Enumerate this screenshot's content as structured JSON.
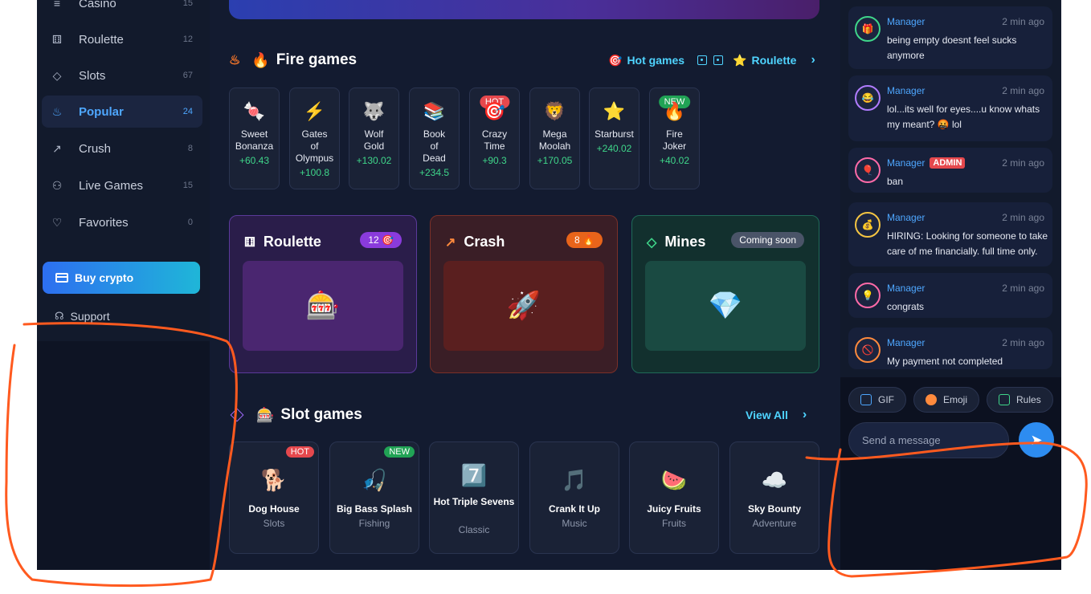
{
  "sidebar": {
    "items": [
      {
        "label": "Casino",
        "count": "15",
        "icon": "casino-icon"
      },
      {
        "label": "Roulette",
        "count": "12",
        "icon": "roulette-icon"
      },
      {
        "label": "Slots",
        "count": "67",
        "icon": "diamond-icon"
      },
      {
        "label": "Popular",
        "count": "24",
        "icon": "flame-icon"
      },
      {
        "label": "Crush",
        "count": "8",
        "icon": "trend-icon"
      },
      {
        "label": "Live Games",
        "count": "15",
        "icon": "users-icon"
      },
      {
        "label": "Favorites",
        "count": "0",
        "icon": "heart-icon"
      }
    ],
    "buy_label": "Buy crypto",
    "support_label": "Support"
  },
  "fire": {
    "title": "Fire games",
    "tabs": {
      "hot": "Hot games",
      "roulette": "Roulette"
    },
    "games": [
      {
        "name": "Sweet Bonanza",
        "value": "+60.43",
        "emoji": "🍬"
      },
      {
        "name": "Gates of Olympus",
        "value": "+100.8",
        "emoji": "⚡"
      },
      {
        "name": "Wolf Gold",
        "value": "+130.02",
        "emoji": "🐺"
      },
      {
        "name": "Book of Dead",
        "value": "+234.5",
        "emoji": "📚"
      },
      {
        "name": "Crazy Time",
        "value": "+90.3",
        "emoji": "🎯",
        "tag": "HOT"
      },
      {
        "name": "Mega Moolah",
        "value": "+170.05",
        "emoji": "🦁"
      },
      {
        "name": "Starburst",
        "value": "+240.02",
        "emoji": "⭐"
      },
      {
        "name": "Fire Joker",
        "value": "+40.02",
        "emoji": "🔥",
        "tag": "NEW"
      }
    ]
  },
  "modes": {
    "roulette": {
      "title": "Roulette",
      "badge": "12 🎯",
      "pic": "🎰"
    },
    "crash": {
      "title": "Crash",
      "badge": "8 🔥",
      "pic": "🚀"
    },
    "mines": {
      "title": "Mines",
      "badge": "Coming soon",
      "pic": "💎"
    }
  },
  "slots": {
    "title": "Slot games",
    "view_all": "View All",
    "games": [
      {
        "name": "Dog House",
        "category": "Slots",
        "emoji": "🐕",
        "tag": "HOT"
      },
      {
        "name": "Big Bass Splash",
        "category": "Fishing",
        "emoji": "🎣",
        "tag": "NEW"
      },
      {
        "name": "Hot Triple Sevens",
        "category": "Classic",
        "emoji": "7️⃣"
      },
      {
        "name": "Crank It Up",
        "category": "Music",
        "emoji": "🎵"
      },
      {
        "name": "Juicy Fruits",
        "category": "Fruits",
        "emoji": "🍉"
      },
      {
        "name": "Sky Bounty",
        "category": "Adventure",
        "emoji": "☁️"
      }
    ]
  },
  "chat": {
    "messages": [
      {
        "user": "Manager",
        "time": "2 min ago",
        "text": "being empty doesnt feel sucks anymore",
        "avatar": "🎁",
        "ring": "#3fd68a"
      },
      {
        "user": "Manager",
        "time": "2 min ago",
        "text": "lol...its well for eyes....u know whats my meant? 🤬 lol",
        "avatar": "😂",
        "ring": "#b07cff"
      },
      {
        "user": "Manager",
        "badge": "ADMIN",
        "time": "2 min ago",
        "text": "ban",
        "avatar": "🎈",
        "ring": "#ff6aa8"
      },
      {
        "user": "Manager",
        "time": "2 min ago",
        "text": "HIRING: Looking for someone to take care of me financially. full time only.",
        "avatar": "💰",
        "ring": "#f5c542"
      },
      {
        "user": "Manager",
        "time": "2 min ago",
        "text": "congrats",
        "avatar": "💡",
        "ring": "#ff6aa8"
      },
      {
        "user": "Manager",
        "time": "2 min ago",
        "text": "My payment not completed",
        "avatar": "🚫",
        "ring": "#ff8a3d"
      }
    ],
    "tools": {
      "gif": "GIF",
      "emoji": "Emoji",
      "rules": "Rules"
    },
    "input_placeholder": "Send a message"
  },
  "colors": {
    "accent": "#4ea7ff",
    "annotation": "#ff5a1f",
    "positive": "#3fd68a"
  }
}
